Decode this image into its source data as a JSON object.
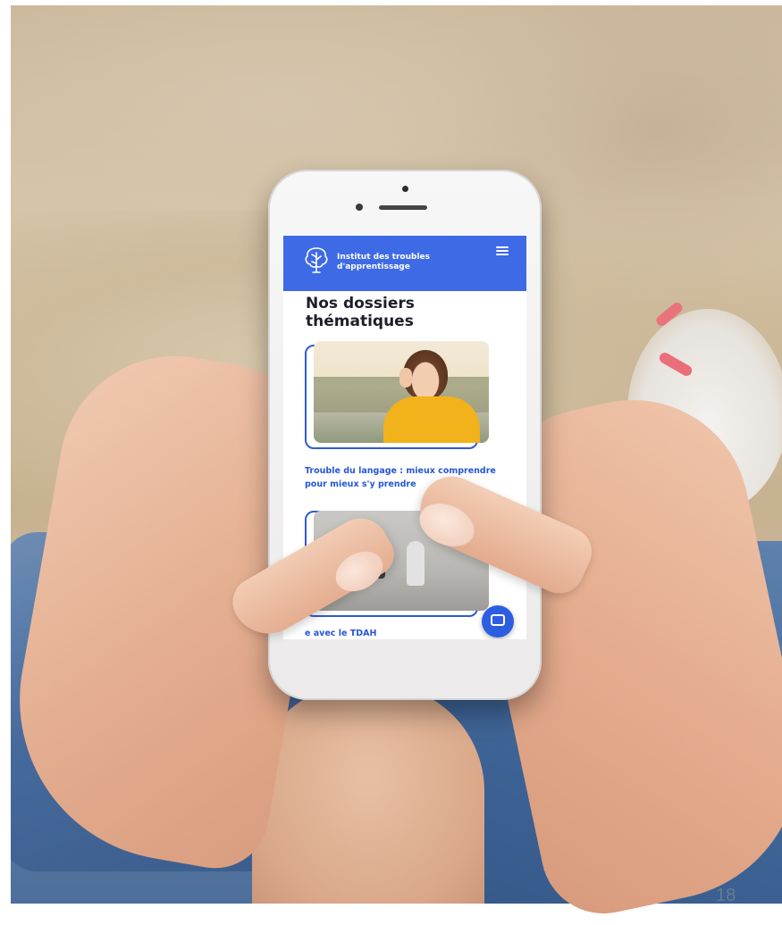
{
  "app": {
    "brand_name": "Institut des troubles d'apprentissage",
    "brand_color": "#3e6ae6",
    "menu_icon": "hamburger-menu-icon",
    "logo_icon": "brain-tree-icon"
  },
  "main": {
    "page_title": "Nos dossiers thématiques",
    "cards": [
      {
        "title": "Trouble du langage : mieux comprendre pour mieux s'y prendre"
      },
      {
        "title_visible": "e avec le TDAH"
      }
    ],
    "chat_icon": "chat-bubble-icon",
    "link_color": "#2756d6"
  },
  "slide": {
    "page_number": "18"
  }
}
